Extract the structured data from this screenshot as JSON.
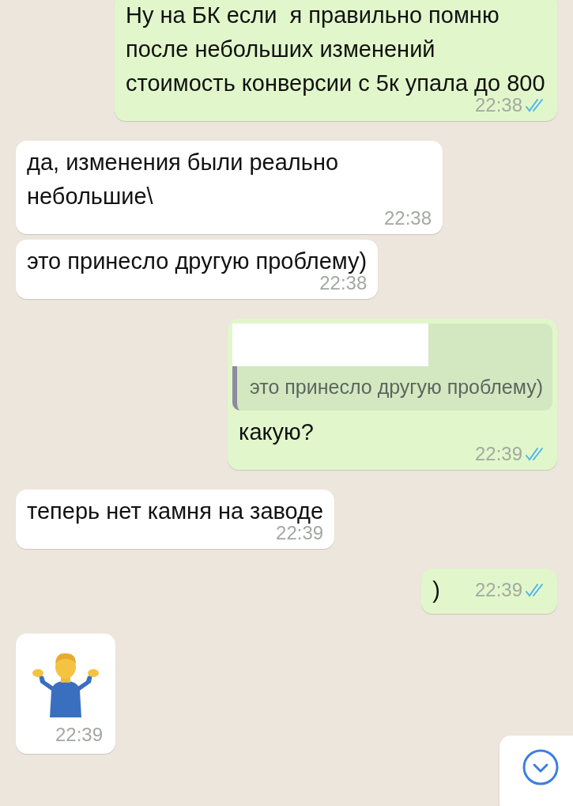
{
  "messages": [
    {
      "kind": "text",
      "outgoing": true,
      "text": "Ну на БК если  я правильно помню после небольших изменений стоимость конверсии с 5к упала до 800",
      "time": "22:38",
      "read": true
    },
    {
      "kind": "text",
      "outgoing": false,
      "text": "да, изменения были реально небольшие\\",
      "time": "22:38"
    },
    {
      "kind": "text",
      "outgoing": false,
      "text": "это принесло другую проблему)",
      "time": "22:38"
    },
    {
      "kind": "quote",
      "outgoing": true,
      "quote": "это принесло другую проблему)",
      "text": "какую?",
      "time": "22:39",
      "read": true
    },
    {
      "kind": "text",
      "outgoing": false,
      "text": "теперь нет камня на заводе",
      "time": "22:39"
    },
    {
      "kind": "text",
      "outgoing": true,
      "text": ")",
      "time": "22:39",
      "read": true
    },
    {
      "kind": "sticker",
      "outgoing": false,
      "time": "22:39"
    }
  ]
}
